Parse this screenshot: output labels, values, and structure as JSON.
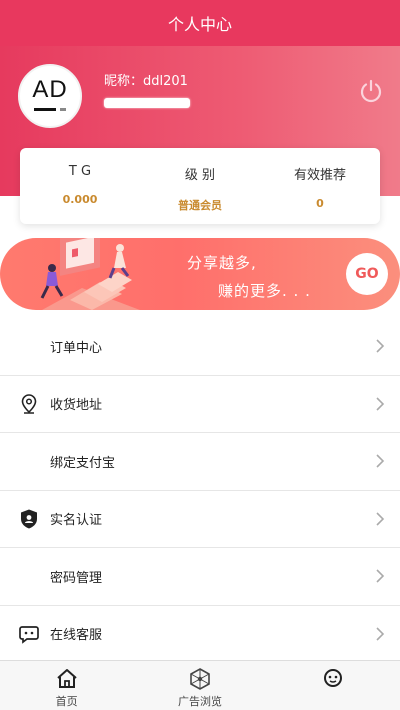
{
  "header": {
    "title": "个人中心"
  },
  "profile": {
    "avatar_text": "AD",
    "nickname": "昵称：ddl201",
    "power_icon": "power-icon"
  },
  "stats": [
    {
      "label": "T G",
      "value": "0.000"
    },
    {
      "label": "级 别",
      "value": "普通会员"
    },
    {
      "label": "有效推荐",
      "value": "0"
    }
  ],
  "banner": {
    "line1": "分享越多,",
    "line2": "赚的更多. . .",
    "button": "GO"
  },
  "menu": [
    {
      "label": "订单中心",
      "icon": ""
    },
    {
      "label": "收货地址",
      "icon": "location-pin-icon"
    },
    {
      "label": "绑定支付宝",
      "icon": ""
    },
    {
      "label": "实名认证",
      "icon": "shield-user-icon"
    },
    {
      "label": "密码管理",
      "icon": ""
    },
    {
      "label": "在线客服",
      "icon": "chat-icon"
    }
  ],
  "tabbar": [
    {
      "label": "首页",
      "icon": "home-icon"
    },
    {
      "label": "广告浏览",
      "icon": "network-icon"
    },
    {
      "label": "",
      "icon": "face-icon"
    }
  ],
  "colors": {
    "header": "#e8385e",
    "accent_gold": "#c98a2e",
    "banner": "#ff7a6e"
  }
}
